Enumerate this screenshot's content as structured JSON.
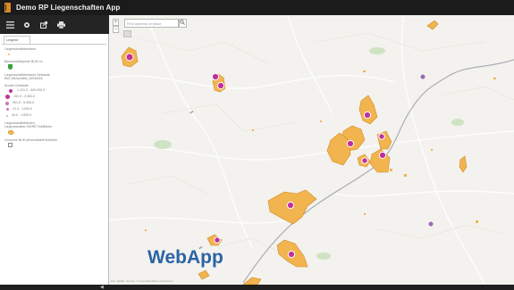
{
  "app": {
    "title": "Demo RP Liegenschaften App",
    "brand_color": "#d98a2b"
  },
  "toolbar": {
    "items": [
      "menu-icon",
      "gear-icon",
      "share-icon",
      "print-icon"
    ]
  },
  "sidebar": {
    "tab_label": "Legend",
    "legend": {
      "layer1_title": "Liegenschaftsbestand",
      "layer2_title": "Bauschuttdeponie BUD Liv",
      "layer3_title": "Liegenschaftsbestand Gebäude",
      "layer3_subtitle": "BW_Merschfeld_DENKMA",
      "layer3_group": "Anzahl Gebäude",
      "classes": [
        "1.121.3 - 500.000,3",
        "151.9 - 2.000,0",
        "001.0 - 5.000,0",
        "12.3 - 1.000,0",
        "40.0 - 1.000,0"
      ],
      "layer4_title": "Liegenschaftsflächen",
      "layer4_subtitle": "Liegenschaften BGRE Feldfläche",
      "layer5_title": "Lemzone BUD pleuschstadt flurstück",
      "colors": {
        "magenta": "#c0309a",
        "orange": "#f2b44e",
        "green": "#3aa13a"
      }
    }
  },
  "map": {
    "search_placeholder": "Find address or place",
    "zoom_in": "+",
    "zoom_out": "−",
    "watermark": "WebApp",
    "attribution": "Esri, HERE, Garmin, © OpenStreetMap contributors"
  }
}
